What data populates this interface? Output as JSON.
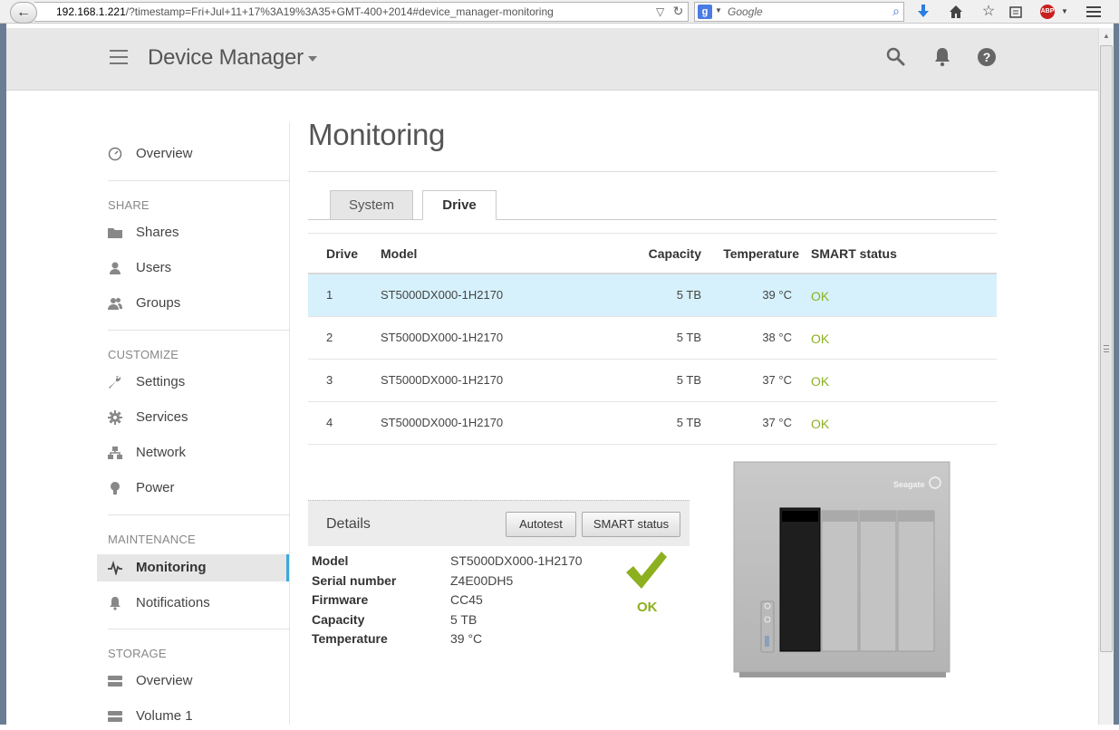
{
  "browser": {
    "url_host": "192.168.1.221",
    "url_path": "/?timestamp=Fri+Jul+11+17%3A19%3A35+GMT-400+2014#device_manager-monitoring",
    "search_placeholder": "Google",
    "abp_label": "ABP"
  },
  "header": {
    "title": "Device Manager"
  },
  "sidebar": {
    "items": [
      {
        "label": "Overview"
      },
      {
        "label": "Shares"
      },
      {
        "label": "Users"
      },
      {
        "label": "Groups"
      },
      {
        "label": "Settings"
      },
      {
        "label": "Services"
      },
      {
        "label": "Network"
      },
      {
        "label": "Power"
      },
      {
        "label": "Monitoring"
      },
      {
        "label": "Notifications"
      },
      {
        "label": "Overview"
      },
      {
        "label": "Volume 1"
      }
    ],
    "sections": {
      "share": "SHARE",
      "customize": "CUSTOMIZE",
      "maintenance": "MAINTENANCE",
      "storage": "STORAGE"
    },
    "active_item": "Monitoring",
    "accent_color": "#39a9dc"
  },
  "main": {
    "title": "Monitoring",
    "tabs": [
      {
        "label": "System",
        "active": false
      },
      {
        "label": "Drive",
        "active": true
      }
    ]
  },
  "table": {
    "headers": {
      "drive": "Drive",
      "model": "Model",
      "capacity": "Capacity",
      "temperature": "Temperature",
      "smart": "SMART status"
    },
    "rows": [
      {
        "drive": "1",
        "model": "ST5000DX000-1H2170",
        "capacity": "5 TB",
        "temperature": "39 °C",
        "smart": "OK",
        "selected": true
      },
      {
        "drive": "2",
        "model": "ST5000DX000-1H2170",
        "capacity": "5 TB",
        "temperature": "38 °C",
        "smart": "OK",
        "selected": false
      },
      {
        "drive": "3",
        "model": "ST5000DX000-1H2170",
        "capacity": "5 TB",
        "temperature": "37 °C",
        "smart": "OK",
        "selected": false
      },
      {
        "drive": "4",
        "model": "ST5000DX000-1H2170",
        "capacity": "5 TB",
        "temperature": "37 °C",
        "smart": "OK",
        "selected": false
      }
    ],
    "selected_color": "#d6f1fb",
    "ok_color": "#8cb01f"
  },
  "details": {
    "title": "Details",
    "autotest_label": "Autotest",
    "smart_label": "SMART status",
    "fields": [
      {
        "label": "Model",
        "value": "ST5000DX000-1H2170"
      },
      {
        "label": "Serial number",
        "value": "Z4E00DH5"
      },
      {
        "label": "Firmware",
        "value": "CC45"
      },
      {
        "label": "Capacity",
        "value": "5 TB"
      },
      {
        "label": "Temperature",
        "value": "39 °C"
      }
    ],
    "status": "OK"
  },
  "device": {
    "brand": "Seagate",
    "highlighted_bay": 1
  }
}
